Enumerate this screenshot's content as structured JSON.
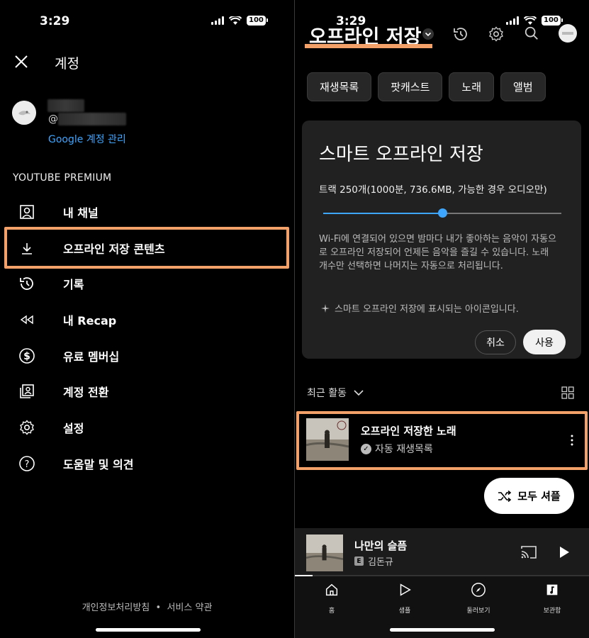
{
  "status": {
    "time": "3:29",
    "battery": "100"
  },
  "account": {
    "title": "계정",
    "handle_prefix": "@",
    "manage_link": "Google 계정 관리",
    "section": "YOUTUBE PREMIUM",
    "menu": [
      {
        "label": "내 채널",
        "icon": "person-box-icon"
      },
      {
        "label": "오프라인 저장 콘텐츠",
        "icon": "download-icon"
      },
      {
        "label": "기록",
        "icon": "history-icon"
      },
      {
        "label": "내 Recap",
        "icon": "rewind-icon"
      },
      {
        "label": "유료 멤버십",
        "icon": "dollar-icon"
      },
      {
        "label": "계정 전환",
        "icon": "switch-account-icon"
      },
      {
        "label": "설정",
        "icon": "gear-icon"
      },
      {
        "label": "도움말 및 의견",
        "icon": "help-icon"
      }
    ],
    "footer": {
      "privacy": "개인정보처리방침",
      "sep": "•",
      "terms": "서비스 약관"
    }
  },
  "offline": {
    "title": "오프라인 저장",
    "chips": [
      "재생목록",
      "팟캐스트",
      "노래",
      "앨범"
    ],
    "smart": {
      "title": "스마트 오프라인 저장",
      "subtitle": "트랙 250개(1000분, 736.6MB, 가능한 경우 오디오만)",
      "slider_fraction": 0.5,
      "description": "Wi-Fi에 연결되어 있으면 밤마다 내가 좋아하는 음악이 자동으로 오프라인 저장되어 언제든 음악을 즐길 수 있습니다. 노래 개수만 선택하면 나머지는 자동으로 처리됩니다.",
      "note": "스마트 오프라인 저장에 표시되는 아이콘입니다.",
      "cancel": "취소",
      "use": "사용"
    },
    "recent_label": "최근 활동",
    "recent_item": {
      "title": "오프라인 저장한 노래",
      "subtitle": "자동 재생목록"
    },
    "shuffle": "모두 셔플",
    "now_playing": {
      "title": "나만의 슬픔",
      "artist": "김돈규",
      "explicit": "E",
      "progress": 0.06
    },
    "tabs": [
      "홈",
      "샘플",
      "둘러보기",
      "보관함"
    ]
  },
  "colors": {
    "highlight": "#f4a069",
    "accent": "#3ea6ff"
  }
}
